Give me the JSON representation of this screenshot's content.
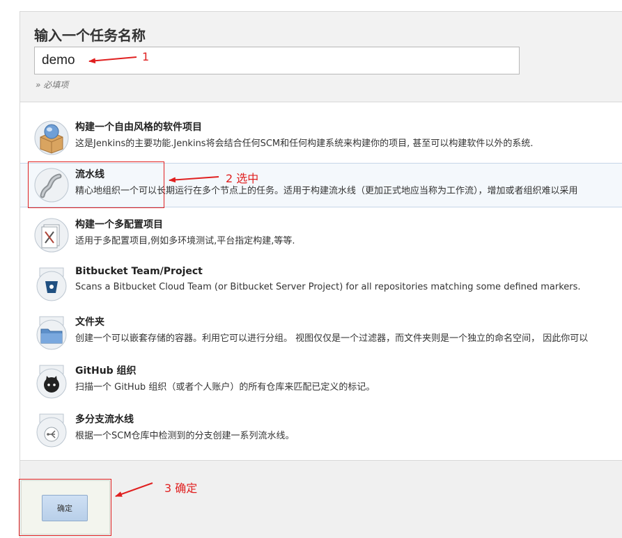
{
  "form": {
    "title": "输入一个任务名称",
    "name_value": "demo",
    "required_hint": "» 必填项"
  },
  "items": [
    {
      "title": "构建一个自由风格的软件项目",
      "desc": "这是Jenkins的主要功能.Jenkins将会结合任何SCM和任何构建系统来构建你的项目, 甚至可以构建软件以外的系统.",
      "icon": "freestyle-box-icon"
    },
    {
      "title": "流水线",
      "desc": "精心地组织一个可以长期运行在多个节点上的任务。适用于构建流水线（更加正式地应当称为工作流），增加或者组织难以采用",
      "icon": "pipeline-icon"
    },
    {
      "title": "构建一个多配置项目",
      "desc": "适用于多配置项目,例如多环境测试,平台指定构建,等等.",
      "icon": "multi-config-icon"
    },
    {
      "title": "Bitbucket Team/Project",
      "desc": "Scans a Bitbucket Cloud Team (or Bitbucket Server Project) for all repositories matching some defined markers.",
      "icon": "bitbucket-icon"
    },
    {
      "title": "文件夹",
      "desc": "创建一个可以嵌套存储的容器。利用它可以进行分组。 视图仅仅是一个过滤器，而文件夹则是一个独立的命名空间， 因此你可以",
      "icon": "folder-icon"
    },
    {
      "title": "GitHub 组织",
      "desc": "扫描一个 GitHub 组织（或者个人账户）的所有仓库来匹配已定义的标记。",
      "icon": "github-icon"
    },
    {
      "title": "多分支流水线",
      "desc": "根据一个SCM仓库中检测到的分支创建一系列流水线。",
      "icon": "multibranch-icon"
    }
  ],
  "footer": {
    "ok_label": "确定"
  },
  "annotations": {
    "step1": "1",
    "step2": "2 选中",
    "step3": "3 确定",
    "color": "#e02020"
  }
}
